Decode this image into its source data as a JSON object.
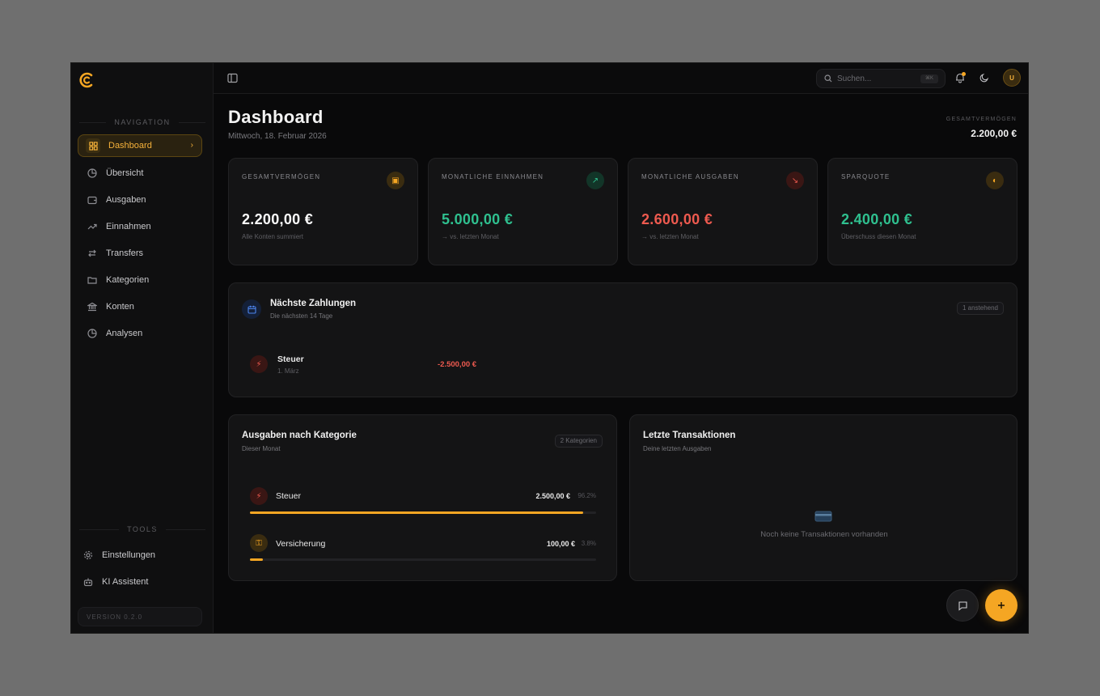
{
  "sidebar": {
    "nav_heading": "NAVIGATION",
    "tools_heading": "TOOLS",
    "items": [
      {
        "label": "Dashboard",
        "icon": "grid-icon"
      },
      {
        "label": "Übersicht",
        "icon": "pie-chart-icon"
      },
      {
        "label": "Ausgaben",
        "icon": "wallet-icon"
      },
      {
        "label": "Einnahmen",
        "icon": "trend-up-icon"
      },
      {
        "label": "Transfers",
        "icon": "arrows-swap-icon"
      },
      {
        "label": "Kategorien",
        "icon": "folder-icon"
      },
      {
        "label": "Konten",
        "icon": "bank-icon"
      },
      {
        "label": "Analysen",
        "icon": "pie-chart-icon"
      }
    ],
    "tools": [
      {
        "label": "Einstellungen",
        "icon": "gear-icon"
      },
      {
        "label": "KI Assistent",
        "icon": "bot-icon"
      }
    ],
    "version": "VERSION 0.2.0"
  },
  "topbar": {
    "search_placeholder": "Suchen...",
    "search_shortcut": "⌘K",
    "avatar_initial": "U"
  },
  "header": {
    "title": "Dashboard",
    "date": "Mittwoch, 18. Februar 2026",
    "total_label": "GESAMTVERMÖGEN",
    "total_value": "2.200,00 €"
  },
  "stats": [
    {
      "label": "GESAMTVERMÖGEN",
      "value": "2.200,00 €",
      "sub": "Alle Konten summiert",
      "color": "#ffffff",
      "icon": "wallet-icon",
      "icon_color": "#f5a623",
      "icon_bg": "#3a2c10"
    },
    {
      "label": "MONATLICHE EINNAHMEN",
      "value": "5.000,00 €",
      "sub": "→ vs. letzten Monat",
      "color": "#2fc08f",
      "icon": "arrow-up-right-icon",
      "icon_color": "#2fc08f",
      "icon_bg": "#123528"
    },
    {
      "label": "MONATLICHE AUSGABEN",
      "value": "2.600,00 €",
      "sub": "→ vs. letzten Monat",
      "color": "#ee5a4f",
      "icon": "arrow-down-right-icon",
      "icon_color": "#ee5a4f",
      "icon_bg": "#3a1614"
    },
    {
      "label": "SPARQUOTE",
      "value": "2.400,00 €",
      "sub": "Überschuss diesen Monat",
      "color": "#2fc08f",
      "icon": "piggy-bank-icon",
      "icon_color": "#f5a623",
      "icon_bg": "#3a2c10"
    }
  ],
  "payments": {
    "title": "Nächste Zahlungen",
    "subtitle": "Die nächsten 14 Tage",
    "badge": "1 anstehend",
    "items": [
      {
        "name": "Steuer",
        "date": "1. März",
        "amount": "-2.500,00 €"
      }
    ]
  },
  "categories": {
    "title": "Ausgaben nach Kategorie",
    "subtitle": "Dieser Monat",
    "badge": "2 Kategorien",
    "items": [
      {
        "name": "Steuer",
        "amount": "2.500,00 €",
        "percent": "96.2%",
        "fraction": 0.962,
        "icon": "bolt-icon",
        "icon_color": "#ee5a4f",
        "icon_bg": "#3a1614"
      },
      {
        "name": "Versicherung",
        "amount": "100,00 €",
        "percent": "3.8%",
        "fraction": 0.038,
        "icon": "key-icon",
        "icon_color": "#f5a623",
        "icon_bg": "#3a2c10"
      }
    ]
  },
  "transactions": {
    "title": "Letzte Transaktionen",
    "subtitle": "Deine letzten Ausgaben",
    "empty": "Noch keine Transaktionen vorhanden"
  },
  "accent": "#f5a623"
}
